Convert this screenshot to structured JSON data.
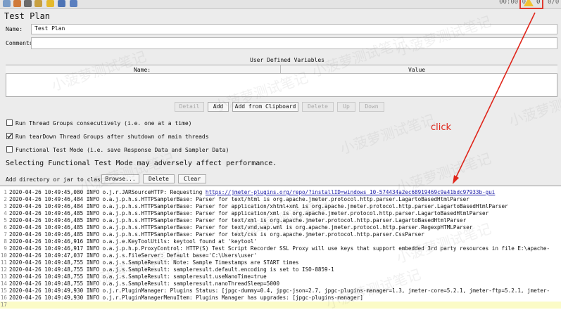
{
  "toolbar": {
    "timer": "00:00:0",
    "warning_count": "0",
    "right_count": "0/0"
  },
  "panel": {
    "title": "Test Plan",
    "name_label": "Name:",
    "name_value": "Test Plan",
    "comments_label": "Comments:",
    "comments_value": "",
    "udv_title": "User Defined Variables",
    "udv_columns": [
      "Name:",
      "Value"
    ],
    "buttons": [
      "Detail",
      "Add",
      "Add from Clipboard",
      "Delete",
      "Up",
      "Down"
    ],
    "checkboxes": [
      {
        "label": "Run Thread Groups consecutively (i.e. one at a time)",
        "checked": false
      },
      {
        "label": "Run tearDown Thread Groups after shutdown of main threads",
        "checked": true
      },
      {
        "label": "Functional Test Mode (i.e. save Response Data and Sampler Data)",
        "checked": false
      }
    ],
    "perf_warning": "Selecting Functional Test Mode may adversely affect performance.",
    "classpath_label": "Add directory or jar to classpath",
    "classpath_buttons": [
      "Browse...",
      "Delete",
      "Clear"
    ]
  },
  "annotation": {
    "click_text": "click",
    "color": "#e0261b"
  },
  "watermark": "小菠萝测试笔记",
  "log": [
    {
      "n": "1",
      "pre": "2020-04-26 10:49:45,080 INFO o.j.r.JARSourceHTTP: Requesting ",
      "link": "https://jmeter-plugins.org/repo/?installID=windows_10-574434a2ec68919469c9a41bdc97933b-gui",
      "post": ""
    },
    {
      "n": "2",
      "pre": "2020-04-26 10:49:46,484 INFO o.a.j.p.h.s.HTTPSamplerBase: Parser for text/html is org.apache.jmeter.protocol.http.parser.LagartoBasedHtmlParser"
    },
    {
      "n": "3",
      "pre": "2020-04-26 10:49:46,484 INFO o.a.j.p.h.s.HTTPSamplerBase: Parser for application/xhtml+xml is org.apache.jmeter.protocol.http.parser.LagartoBasedHtmlParser"
    },
    {
      "n": "4",
      "pre": "2020-04-26 10:49:46,485 INFO o.a.j.p.h.s.HTTPSamplerBase: Parser for application/xml is org.apache.jmeter.protocol.http.parser.LagartoBasedHtmlParser"
    },
    {
      "n": "5",
      "pre": "2020-04-26 10:49:46,485 INFO o.a.j.p.h.s.HTTPSamplerBase: Parser for text/xml is org.apache.jmeter.protocol.http.parser.LagartoBasedHtmlParser"
    },
    {
      "n": "6",
      "pre": "2020-04-26 10:49:46,485 INFO o.a.j.p.h.s.HTTPSamplerBase: Parser for text/vnd.wap.wml is org.apache.jmeter.protocol.http.parser.RegexpHTMLParser"
    },
    {
      "n": "7",
      "pre": "2020-04-26 10:49:46,485 INFO o.a.j.p.h.s.HTTPSamplerBase: Parser for text/css is org.apache.jmeter.protocol.http.parser.CssParser"
    },
    {
      "n": "8",
      "pre": "2020-04-26 10:49:46,916 INFO o.a.j.e.KeyToolUtils: keytool found at 'keytool'"
    },
    {
      "n": "9",
      "pre": "2020-04-26 10:49:46,917 INFO o.a.j.p.h.p.ProxyControl: HTTP(S) Test Script Recorder SSL Proxy will use keys that support embedded 3rd party resources in file E:\\apache-"
    },
    {
      "n": "10",
      "pre": "2020-04-26 10:49:47,037 INFO o.a.j.s.FileServer: Default base='C:\\Users\\user'"
    },
    {
      "n": "11",
      "pre": "2020-04-26 10:49:48,755 INFO o.a.j.s.SampleResult: Note: Sample Timestamps are START times"
    },
    {
      "n": "12",
      "pre": "2020-04-26 10:49:48,755 INFO o.a.j.s.SampleResult: sampleresult.default.encoding is set to ISO-8859-1"
    },
    {
      "n": "13",
      "pre": "2020-04-26 10:49:48,755 INFO o.a.j.s.SampleResult: sampleresult.useNanoTime=true"
    },
    {
      "n": "14",
      "pre": "2020-04-26 10:49:48,755 INFO o.a.j.s.SampleResult: sampleresult.nanoThreadSleep=5000"
    },
    {
      "n": "15",
      "pre": "2020-04-26 10:49:49,930 INFO o.j.r.PluginManager: Plugins Status: [jpgc-dummy=0.4, jpgc-json=2.7, jpgc-plugins-manager=1.3, jmeter-core=5.2.1, jmeter-ftp=5.2.1, jmeter-"
    },
    {
      "n": "16",
      "pre": "2020-04-26 10:49:49,930 INFO o.j.r.PluginManagerMenuItem: Plugins Manager has upgrades: [jpgc-plugins-manager]"
    },
    {
      "n": "17",
      "pre": ""
    }
  ]
}
